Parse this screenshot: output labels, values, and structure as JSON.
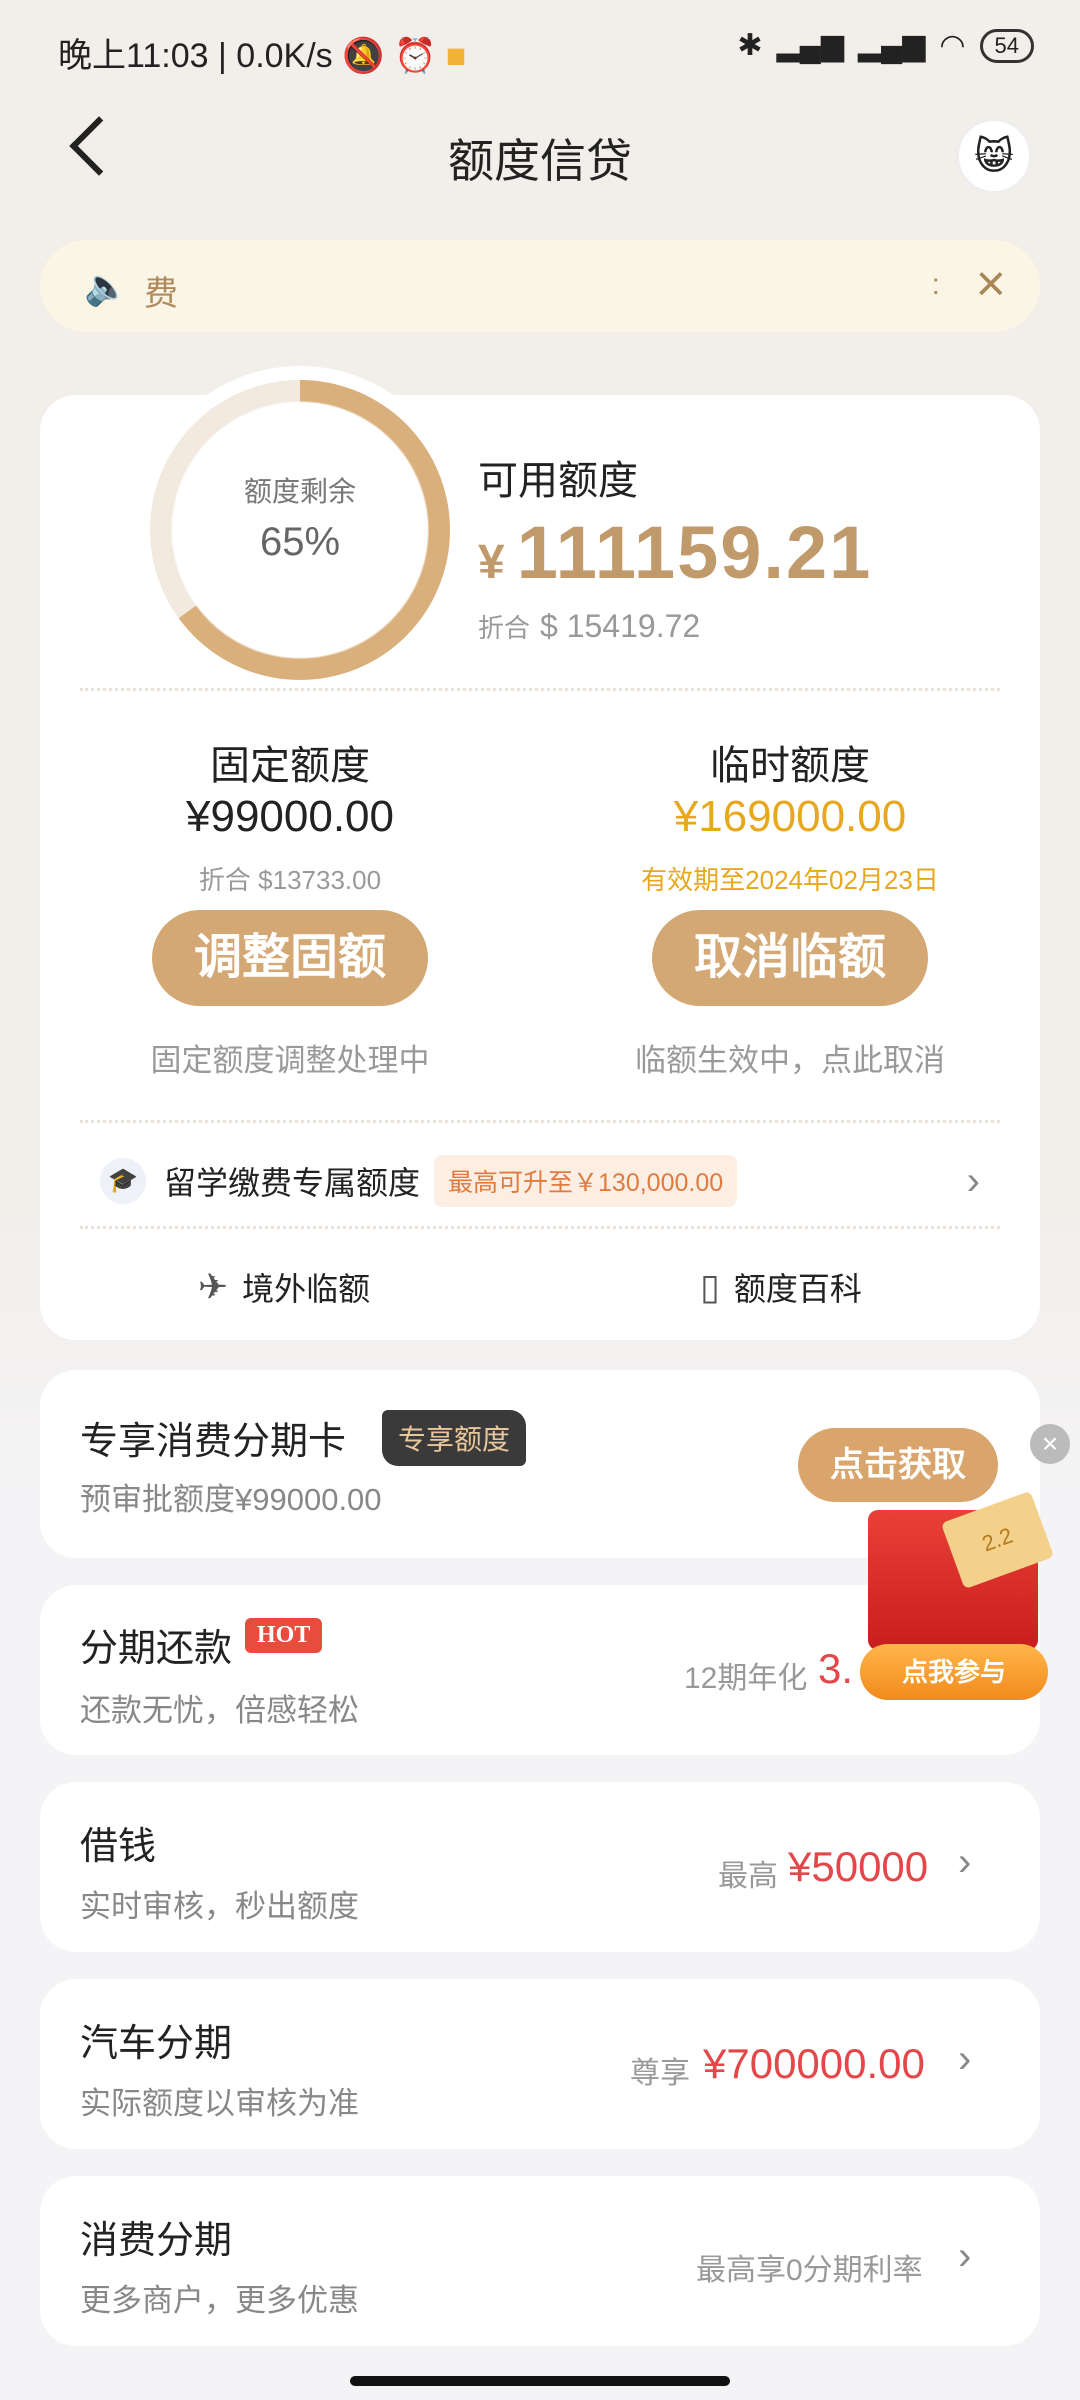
{
  "status_bar": {
    "left": "晚上11:03 | 0.0K/s",
    "right_icons": [
      "bluetooth-icon",
      "signal-icon",
      "signal-icon",
      "wifi-icon"
    ],
    "battery": "54"
  },
  "header": {
    "title": "额度信贷"
  },
  "notice": {
    "text": "费",
    "trailing": ":"
  },
  "quota": {
    "donut_label": "额度剩余",
    "donut_value": "65%",
    "remaining_fraction": 0.65,
    "available_label": "可用额度",
    "currency": "¥",
    "available_amount": "111159.21",
    "converted_prefix": "折合",
    "converted_amount": "$ 15419.72",
    "fixed": {
      "title": "固定额度",
      "amount": "¥99000.00",
      "sub": "折合 $13733.00",
      "button": "调整固额",
      "note": "固定额度调整处理中"
    },
    "temp": {
      "title": "临时额度",
      "amount": "¥169000.00",
      "sub": "有效期至2024年02月23日",
      "button": "取消临额",
      "note": "临额生效中，点此取消"
    },
    "study": {
      "label": "留学缴费专属额度",
      "badge": "最高可升至￥130,000.00"
    },
    "tools": {
      "overseas": "境外临额",
      "wiki": "额度百科"
    }
  },
  "cards": {
    "exclusive": {
      "title": "专享消费分期卡",
      "tag": "专享额度",
      "sub": "预审批额度¥99000.00"
    },
    "installment": {
      "title": "分期还款",
      "hot": "HOT",
      "sub": "还款无忧，倍感轻松",
      "right_label": "12期年化",
      "right_value": "3."
    },
    "borrow": {
      "title": "借钱",
      "sub": "实时审核，秒出额度",
      "right_label": "最高",
      "right_value": "¥50000"
    },
    "car": {
      "title": "汽车分期",
      "sub": "实际额度以审核为准",
      "right_label": "尊享",
      "right_value": "¥700000.00"
    },
    "consume": {
      "title": "消费分期",
      "sub": "更多商户，更多优惠",
      "right_text": "最高享0分期利率"
    }
  },
  "promo": {
    "top_button": "点击获取",
    "bottom_button": "点我参与",
    "ticket": "2.2"
  },
  "colors": {
    "gold": "#c09a6b",
    "button": "#d4a874",
    "temp_amount": "#e8a81e",
    "red": "#e3474a"
  }
}
